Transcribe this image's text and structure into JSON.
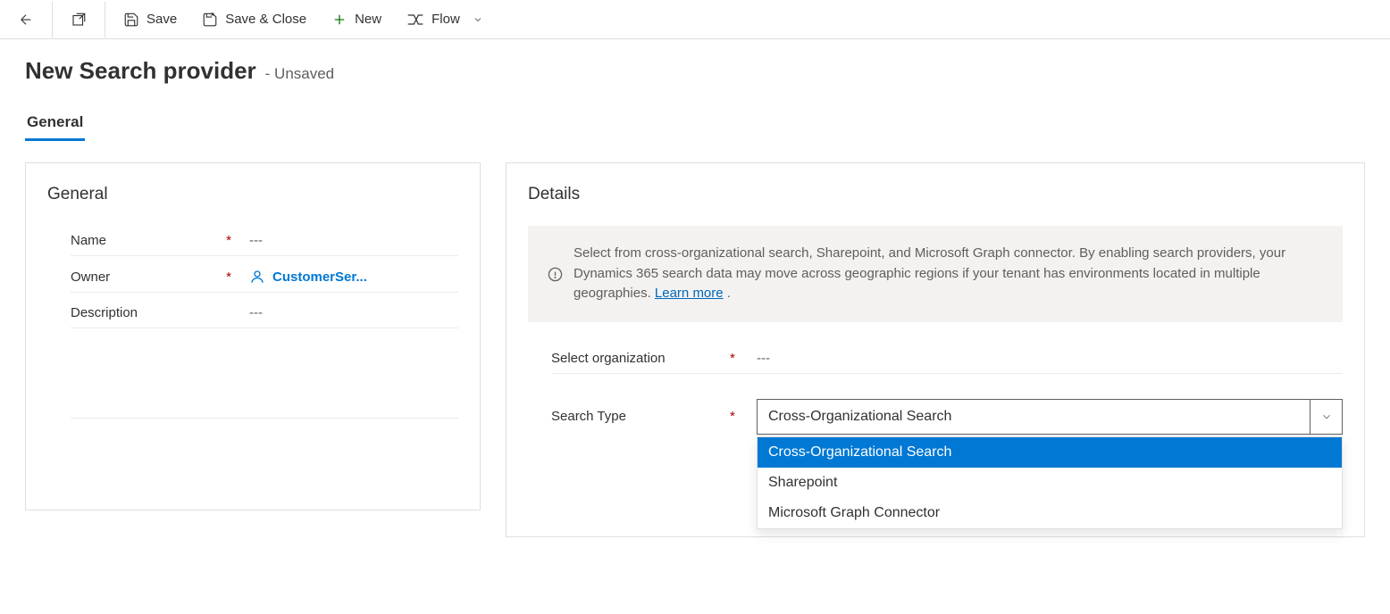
{
  "toolbar": {
    "save_label": "Save",
    "save_close_label": "Save & Close",
    "new_label": "New",
    "flow_label": "Flow"
  },
  "page": {
    "title": "New Search provider",
    "status": "- Unsaved"
  },
  "tabs": {
    "general_label": "General"
  },
  "general_section": {
    "title": "General",
    "name_label": "Name",
    "name_value": "---",
    "owner_label": "Owner",
    "owner_value": "CustomerSer...",
    "description_label": "Description",
    "description_value": "---"
  },
  "details_section": {
    "title": "Details",
    "info_text": "Select from cross-organizational search, Sharepoint, and Microsoft Graph connector. By enabling search providers, your Dynamics 365 search data may move across geographic regions if your tenant has environments located in multiple geographies.  ",
    "learn_more_label": "Learn more",
    "select_org_label": "Select organization",
    "select_org_value": "---",
    "search_type_label": "Search Type",
    "search_type_selected": "Cross-Organizational Search",
    "search_type_options": [
      "Cross-Organizational Search",
      "Sharepoint",
      "Microsoft Graph Connector"
    ]
  }
}
